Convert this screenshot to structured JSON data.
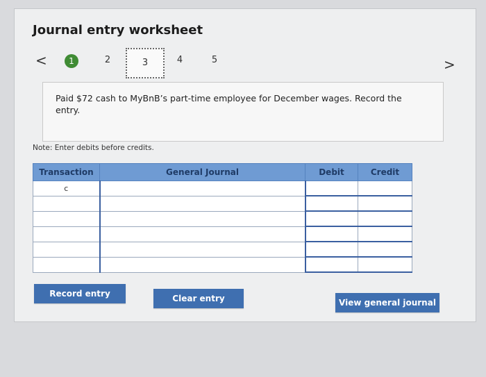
{
  "worksheet": {
    "title": "Journal entry worksheet",
    "nav": {
      "prev": "<",
      "next": ">",
      "steps": [
        "1",
        "2",
        "3",
        "4",
        "5"
      ]
    },
    "prompt": "Paid $72 cash to MyBnB’s part-time employee for December wages. Record the entry.",
    "note": "Note: Enter debits before credits.",
    "table": {
      "headers": [
        "Transaction",
        "General Journal",
        "Debit",
        "Credit"
      ],
      "first_transaction": "c"
    },
    "buttons": {
      "record": "Record entry",
      "clear": "Clear entry",
      "view": "View general journal"
    }
  }
}
